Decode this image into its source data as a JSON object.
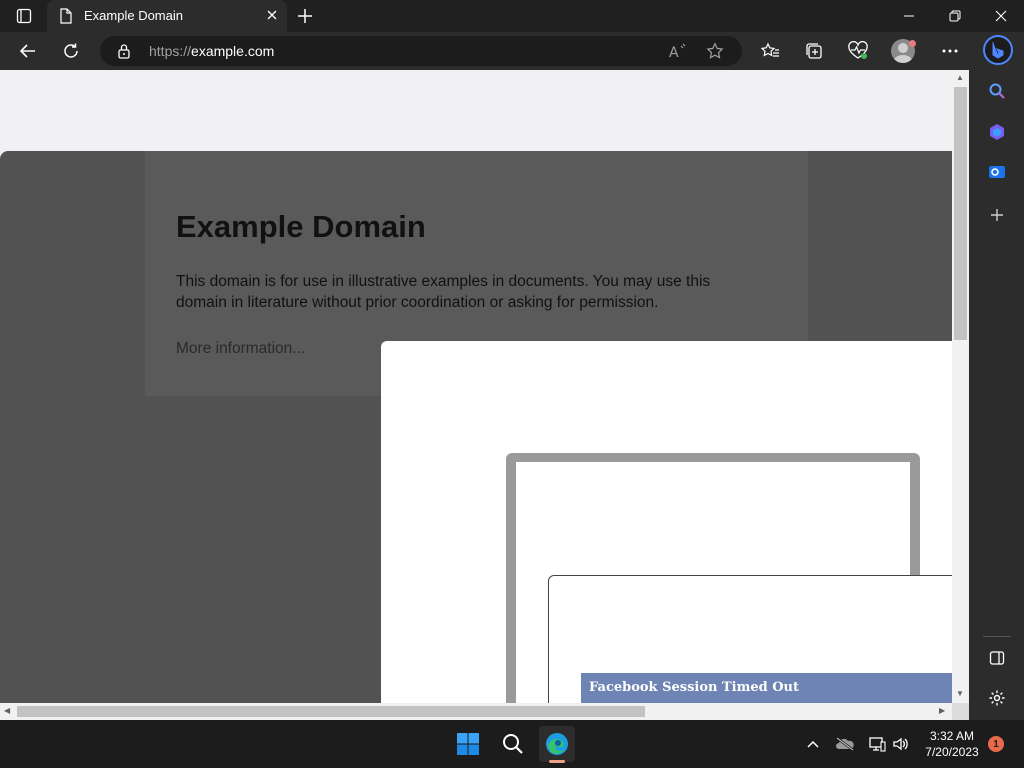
{
  "browser": {
    "tab": {
      "title": "Example Domain",
      "icon": "page-icon",
      "close_icon": "close-icon"
    },
    "new_tab_icon": "plus-icon",
    "window_controls": {
      "minimize": "minimize-icon",
      "restore": "restore-icon",
      "close": "close-icon"
    },
    "address": {
      "scheme": "https://",
      "host": "example.com"
    },
    "toolbar_icons": [
      "back-icon",
      "refresh-icon",
      "lock-icon",
      "read-aloud-icon",
      "favorite-star-icon",
      "favorites-icon",
      "collections-icon",
      "browser-essentials-icon",
      "profile-avatar",
      "more-icon"
    ]
  },
  "sidebar": {
    "items": [
      "bing-chat-icon",
      "search-icon",
      "copilot-icon",
      "outlook-icon",
      "add-icon",
      "hide-sidebar-icon",
      "settings-icon"
    ]
  },
  "page": {
    "heading": "Example Domain",
    "description": "This domain is for use in illustrative examples in documents. You may use this domain in literature without prior coordination or asking for permission.",
    "more_link": "More information..."
  },
  "popup": {
    "title": "Facebook Session Timed Out",
    "header_color": "#6d84b4"
  },
  "taskbar": {
    "icons": [
      "windows-start-icon",
      "search-icon",
      "edge-icon"
    ],
    "tray": [
      "chevron-up-icon",
      "onedrive-icon",
      "network-icon",
      "volume-icon"
    ],
    "time": "3:32 AM",
    "date": "7/20/2023",
    "notification_count": "1"
  },
  "colors": {
    "accent": "#4d86ff",
    "overlay": "#525252",
    "badge": "#e86a4a"
  }
}
